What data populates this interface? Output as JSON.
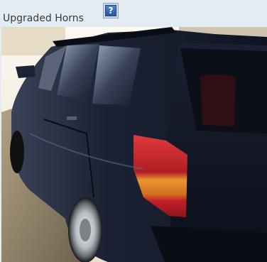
{
  "title": "Upgraded Horns",
  "help_icon": "help-question-icon",
  "help_glyph": "?",
  "photo": {
    "subject": "dark blue hatchback, rear three-quarter view",
    "colors": {
      "body": "#1b2233",
      "taillight": "#c8242b",
      "signal": "#e08a2a",
      "sky": "#f6f2ea",
      "ground": "#7a6c58"
    }
  },
  "theme": {
    "background": "#e3ebf3",
    "title_color": "#3a3a3a",
    "help_blue": "#2f6bb8"
  }
}
